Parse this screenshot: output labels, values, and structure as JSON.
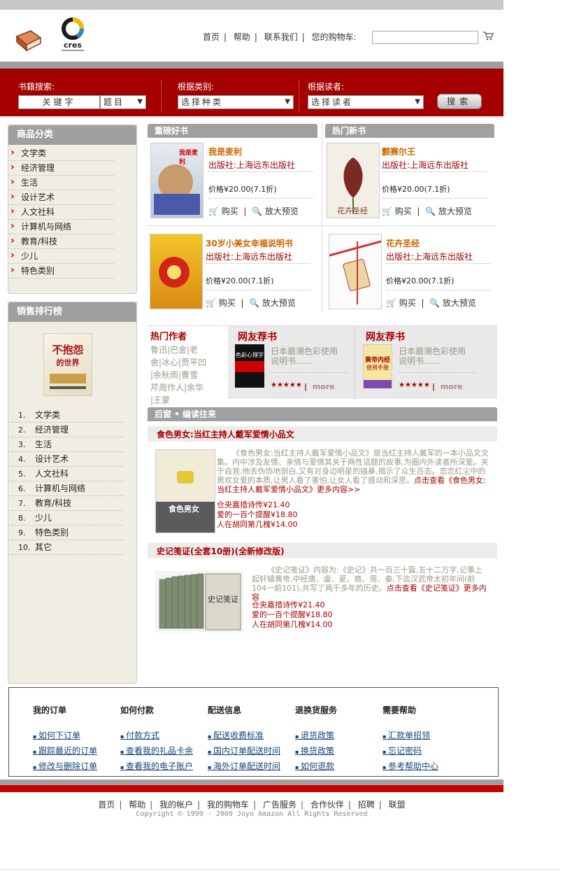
{
  "header": {
    "nav": [
      "首页",
      "帮助",
      "联系我们",
      "您的购物车:"
    ]
  },
  "search": {
    "keyword_label": "书籍搜索:",
    "keyword_value": "关键字",
    "field_value": "题目",
    "category_label": "根据类别:",
    "category_value": "选择种类",
    "reader_label": "根据读者:",
    "reader_value": "选择读者",
    "button": "搜索"
  },
  "categories": {
    "title": "商品分类",
    "items": [
      "文学类",
      "经济管理",
      "生活",
      "设计艺术",
      "人文社科",
      "计算机与网络",
      "教育/科技",
      "少儿",
      "特色类别"
    ]
  },
  "ranking": {
    "title": "销售排行榜",
    "items": [
      "文学类",
      "经济管理",
      "生活",
      "设计艺术",
      "人文社科",
      "计算机与网络",
      "教育/科技",
      "少儿",
      "特色类别",
      "其它"
    ],
    "numbers": [
      "1.",
      "2.",
      "3.",
      "4.",
      "5.",
      "6.",
      "7.",
      "8.",
      "9.",
      "10."
    ]
  },
  "featured": {
    "title": "重磅好书",
    "books": [
      {
        "title": "我是麦利",
        "publisher": "出版社:上海远东出版社",
        "price": "价格¥20.00(7.1折)",
        "buy": "购买",
        "preview": "放大预览"
      },
      {
        "title": "30岁小美女幸福说明书",
        "publisher": "出版社:上海远东出版社",
        "price": "价格¥20.00(7.1折)",
        "buy": "购买",
        "preview": "放大预览"
      }
    ]
  },
  "newbooks": {
    "title": "热门新书",
    "books": [
      {
        "title": "颤赛尔王",
        "publisher": "出版社:上海远东出版社",
        "price": "价格¥20.00(7.1折)",
        "buy": "购买",
        "preview": "放大预览"
      },
      {
        "title": "花卉圣经",
        "publisher": "出版社:上海远东出版社",
        "price": "价格¥20.00(7.1折)",
        "buy": "购买",
        "preview": "放大预览"
      }
    ]
  },
  "authors": {
    "title": "热门作者",
    "lines": [
      "鲁迅|巴金|老",
      "舍|冰心|贾平凹",
      "|余秋雨|曹雪",
      "芹周作人|余华",
      "|王蒙"
    ]
  },
  "recommend": [
    {
      "title": "网友荐书",
      "desc1": "日本最潮色彩使用",
      "desc2": "说明书……",
      "stars": "★★★★★",
      "more": "more",
      "cover_text1": "色彩心理学"
    },
    {
      "title": "网友荐书",
      "desc1": "日本最潮色彩使用",
      "desc2": "说明书……",
      "stars": "★★★★★",
      "more": "more",
      "cover_text1": "黄帝内经",
      "cover_text2": "使用手册"
    }
  ],
  "reviews": {
    "title": "后窗 • 编读往来",
    "items": [
      {
        "heading": "食色男女:当红主持人戴军爱情小品文",
        "body": "《食色男女:当红主持人戴军爱情小品文》是当红主持人戴军的一本小品文文集。内中涉及友情、亲情与爱情其关于两性话题的故事,为圈内外读者所深爱。关于自我,他去伪饰地剖白,又有对身边明星的描摹,揭示了众生百态。恋恋红尘中的男欢女爱的本质,让男人看了害怕,让女人看了感动和深思。",
        "more": "点击查看《食色男女:当红主持人戴军爱情小品文》更多内容>>",
        "links": [
          "仓央嘉措诗传¥21.40",
          "爱的一百个提醒¥18.80",
          "人在胡同第几槐¥14.00"
        ],
        "cover_text": "食色男女"
      },
      {
        "heading": "史记笺证(全套10册)(全新修改版)",
        "body": "《史记笺证》内容为:《史记》共一百三十篇,五十二万字,记事上起轩辕黄帝,中经唐、虞、夏、商、周、秦,下迄汉武帝太初年间(前104一前101),共写了两千多年的历史。",
        "more": "点击查看《史记笺证》更多内容",
        "links": [
          "仓央嘉措诗传¥21.40",
          "爱的一百个提醒¥18.80",
          "人在胡同第几槐¥14.00"
        ],
        "cover_text": "史记笺证"
      }
    ]
  },
  "rank_cover": {
    "title": "不抱怨",
    "subtitle": "的世界"
  },
  "book_covers": {
    "b1_text": "我是麦利",
    "b3_text": "花卉圣经"
  },
  "footer_links": [
    {
      "title": "我的订单",
      "links": [
        "如何下订单",
        "跟踪最近的订单",
        "修改与删除订单"
      ]
    },
    {
      "title": "如何付款",
      "links": [
        "付款方式",
        "查看我的礼品卡余",
        "查看我的电子账户"
      ]
    },
    {
      "title": "配送信息",
      "links": [
        "配送收费标准",
        "国内订单配送时间",
        "海外订单配送时间"
      ]
    },
    {
      "title": "退换货服务",
      "links": [
        "退货政策",
        "换货政策",
        "如何退款"
      ]
    },
    {
      "title": "需要帮助",
      "links": [
        "汇款单招领",
        "忘记密码",
        "参考帮助中心"
      ]
    }
  ],
  "footer": {
    "nav": [
      "首页",
      "帮助",
      "我的帐户",
      "我的购物车",
      "广告服务",
      "合作伙伴",
      "招聘",
      "联盟"
    ],
    "copyright": "Copyright © 1999 - 2009 Joyo Amazon All Rights Reserved"
  },
  "colors": {
    "brand_red": "#a50000",
    "gray_bar": "#a0a0a0"
  }
}
